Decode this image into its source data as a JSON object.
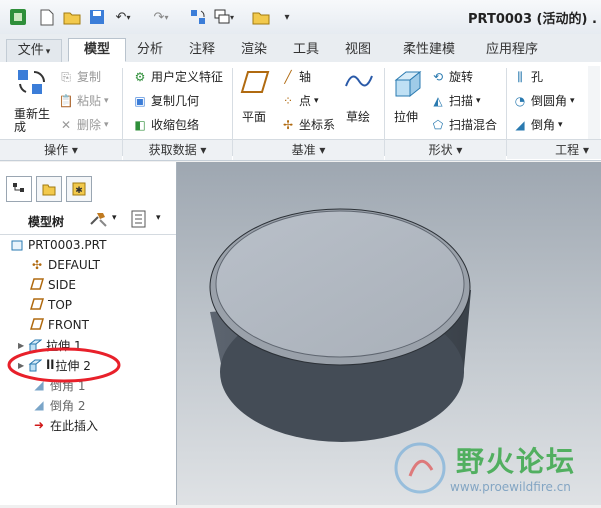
{
  "quick_access": {
    "title": "PRT0003 (活动的) ."
  },
  "tabs": [
    {
      "label": "文件",
      "caret": "▾"
    },
    {
      "label": "模型"
    },
    {
      "label": "分析"
    },
    {
      "label": "注释"
    },
    {
      "label": "渲染"
    },
    {
      "label": "工具"
    },
    {
      "label": "视图"
    },
    {
      "label": "柔性建模"
    },
    {
      "label": "应用程序"
    }
  ],
  "ribbon": {
    "operations": {
      "regen_label": "重新生成",
      "copy_label": "复制",
      "paste_label": "粘贴",
      "delete_label": "删除",
      "group_label": "操作 ▾"
    },
    "get_data": {
      "udf_label": "用户定义特征",
      "copy_geom_label": "复制几何",
      "shrinkwrap_label": "收缩包络",
      "group_label": "获取数据 ▾"
    },
    "datum": {
      "plane_label": "平面",
      "axis_label": "轴",
      "point_label": "点",
      "csys_label": "坐标系",
      "sketch_label": "草绘",
      "group_label": "基准 ▾"
    },
    "shapes": {
      "extrude_label": "拉伸",
      "revolve_label": "旋转",
      "sweep_label": "扫描",
      "blend_label": "扫描混合",
      "group_label": "形状 ▾"
    },
    "engineering": {
      "hole_label": "孔",
      "round_label": "倒圆角",
      "chamfer_label": "倒角",
      "group_label": "工程 ▾"
    }
  },
  "model_tree": {
    "header_label": "模型树",
    "items": [
      {
        "label": "PRT0003.PRT"
      },
      {
        "label": "DEFAULT"
      },
      {
        "label": "SIDE"
      },
      {
        "label": "TOP"
      },
      {
        "label": "FRONT"
      },
      {
        "label": "拉伸 1"
      },
      {
        "label": "拉伸 2"
      },
      {
        "label": "倒角 1"
      },
      {
        "label": "倒角 2"
      },
      {
        "label": "在此插入"
      }
    ]
  },
  "watermark": {
    "title": "野火论坛",
    "url": "www.proewildfire.cn"
  },
  "colors": {
    "active_tab": "#ffffff",
    "annotation_red": "#e8202a",
    "watermark_green": "#3aa84a",
    "part_top": "#b7bec7",
    "part_side": "#4c545e"
  }
}
